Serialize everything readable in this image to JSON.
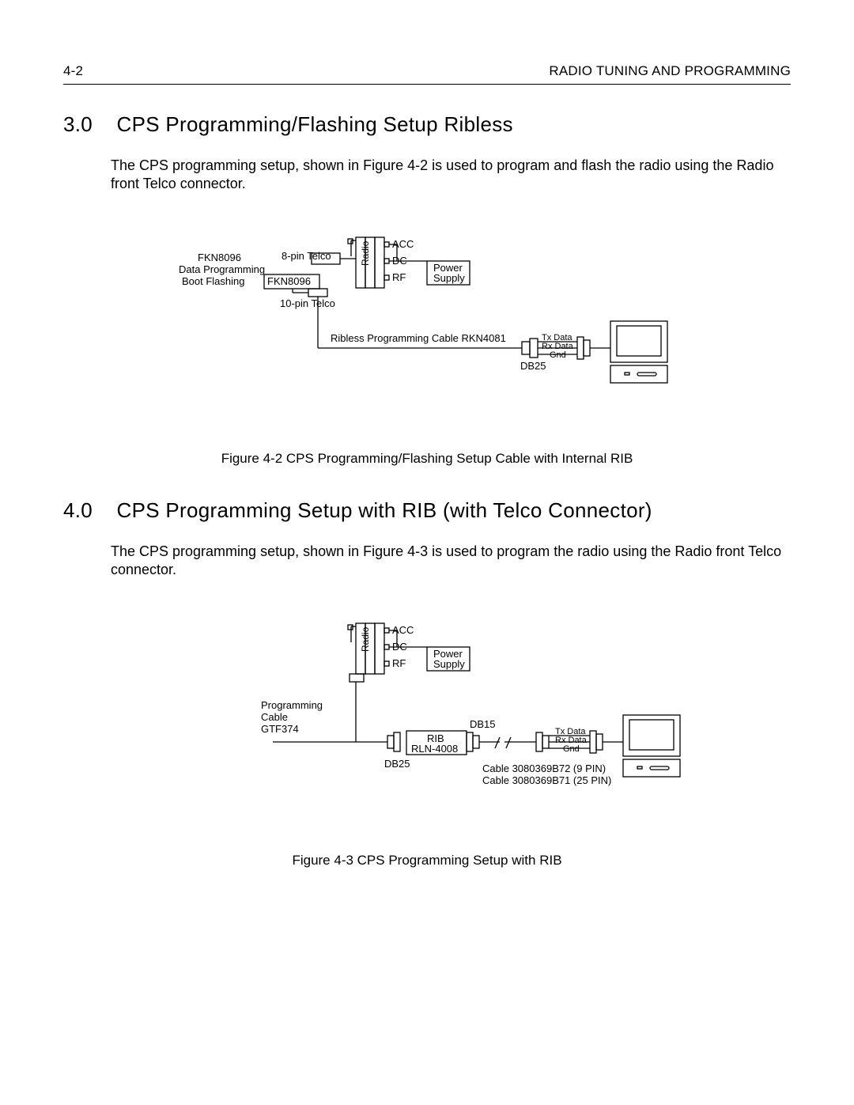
{
  "header": {
    "page_num": "4-2",
    "section": "RADIO TUNING AND PROGRAMMING"
  },
  "s3": {
    "num": "3.0",
    "title": "CPS Programming/Flashing Setup Ribless",
    "body": "The CPS programming setup, shown in Figure 4-2 is used to program and flash the radio using the Radio front Telco connector.",
    "figcaption": "Figure 4-2 CPS Programming/Flashing Setup Cable with Internal RIB"
  },
  "s4": {
    "num": "4.0",
    "title": "CPS Programming Setup with RIB (with Telco Connector)",
    "body": "The CPS programming setup, shown in Figure 4-3 is used to program the radio using the Radio front Telco connector.",
    "figcaption": "Figure 4-3 CPS Programming Setup with RIB"
  },
  "fig42": {
    "fkn_line1": "FKN8096",
    "fkn_line2": "Data  Programming",
    "fkn_line3": "Boot  Flashing",
    "eight_pin": "8-pin Telco",
    "fkn_box": "FKN8096",
    "ten_pin": "10-pin Telco",
    "radio": "Radio",
    "acc": "ACC",
    "dc": "DC",
    "rf": "RF",
    "psu1": "Power",
    "psu2": "Supply",
    "cable": "Ribless Programming Cable RKN4081",
    "db25": "DB25",
    "tx": "Tx Data",
    "rx": "Rx Data",
    "gnd": "Gnd"
  },
  "fig43": {
    "radio": "Radio",
    "acc": "ACC",
    "dc": "DC",
    "rf": "RF",
    "psu1": "Power",
    "psu2": "Supply",
    "prog1": "Programming",
    "prog2": "Cable",
    "prog3": "GTF374",
    "rib1": "RIB",
    "rib2": "RLN-4008",
    "db25": "DB25",
    "db15": "DB15",
    "c9": "Cable 3080369B72 (9 PIN)",
    "c25": "Cable 3080369B71 (25 PIN)",
    "tx": "Tx Data",
    "rx": "Rx Data",
    "gnd": "Gnd"
  }
}
